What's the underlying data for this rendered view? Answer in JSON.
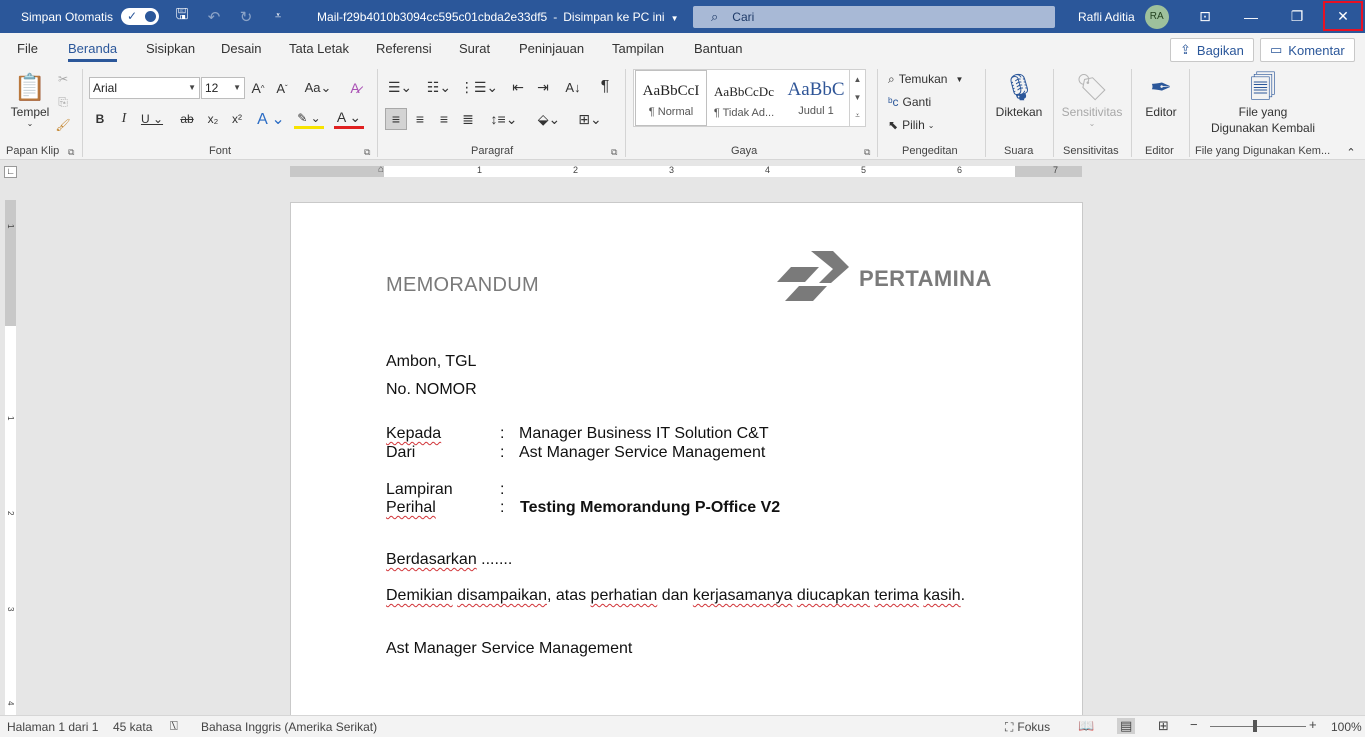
{
  "titlebar": {
    "autosave_label": "Simpan Otomatis",
    "document_name": "Mail-f29b4010b3094cc595c01cbda2e33df5",
    "save_status": "Disimpan ke PC ini",
    "search_placeholder": "Cari",
    "user_name": "Rafli Aditia",
    "user_initials": "RA",
    "colors": {
      "titlebar_bg": "#2b579a",
      "close_highlight": "#e81123"
    }
  },
  "ribbon_tabs": [
    "File",
    "Beranda",
    "Sisipkan",
    "Desain",
    "Tata Letak",
    "Referensi",
    "Surat",
    "Peninjauan",
    "Tampilan",
    "Bantuan"
  ],
  "ribbon_actions": {
    "share": "Bagikan",
    "comment": "Komentar"
  },
  "ribbon": {
    "clipboard": {
      "paste": "Tempel",
      "group": "Papan Klip"
    },
    "font": {
      "name": "Arial",
      "size": "12",
      "group": "Font"
    },
    "paragraph": {
      "group": "Paragraf"
    },
    "styles": {
      "items": [
        {
          "sample": "AaBbCcI",
          "name": "¶ Normal"
        },
        {
          "sample": "AaBbCcDc",
          "name": "¶ Tidak Ad..."
        },
        {
          "sample": "AaBbC",
          "name": "Judul 1"
        }
      ],
      "group": "Gaya"
    },
    "editing": {
      "find": "Temukan",
      "replace": "Ganti",
      "select": "Pilih",
      "group": "Pengeditan"
    },
    "voice": {
      "dictate": "Diktekan",
      "group": "Suara"
    },
    "sensitivity": {
      "label": "Sensitivitas",
      "group": "Sensitivitas"
    },
    "editor": {
      "label": "Editor",
      "group": "Editor"
    },
    "reuse": {
      "line1": "File yang",
      "line2": "Digunakan Kembali",
      "group": "File yang Digunakan Kem..."
    }
  },
  "ruler": {
    "h_numbers": [
      "1",
      "2",
      "3",
      "4",
      "5",
      "6",
      "7"
    ],
    "v_numbers": [
      "1",
      "1",
      "2",
      "3",
      "4"
    ]
  },
  "document": {
    "memo_title": "MEMORANDUM",
    "logo_text": "PERTAMINA",
    "place_date": "Ambon,  TGL",
    "number": "No.  NOMOR",
    "to_label": "Kepada",
    "to_value": "Manager Business IT Solution C&T",
    "from_label": "Dari",
    "from_value": "Ast Manager Service Management",
    "attachment_label": "Lampiran",
    "subject_label": "Perihal",
    "subject_value": "Testing Memorandung P-Office V2",
    "colon": ":",
    "body_word": "Berdasarkan",
    "body_ellipsis": " .......",
    "closing": {
      "w1": "Demikian",
      "w2": "disampaikan",
      "w3": ", atas ",
      "w4": "perhatian",
      "w5": " dan ",
      "w6": "kerjasamanya",
      "w7": " ",
      "w8": "diucapkan",
      "w9": " ",
      "w10": "terima",
      "w11": " ",
      "w12": "kasih",
      "w13": "."
    },
    "signature": "Ast Manager Service Management"
  },
  "statusbar": {
    "page": "Halaman 1 dari 1",
    "words": "45 kata",
    "language": "Bahasa Inggris (Amerika Serikat)",
    "focus": "Fokus",
    "zoom": "100%"
  }
}
